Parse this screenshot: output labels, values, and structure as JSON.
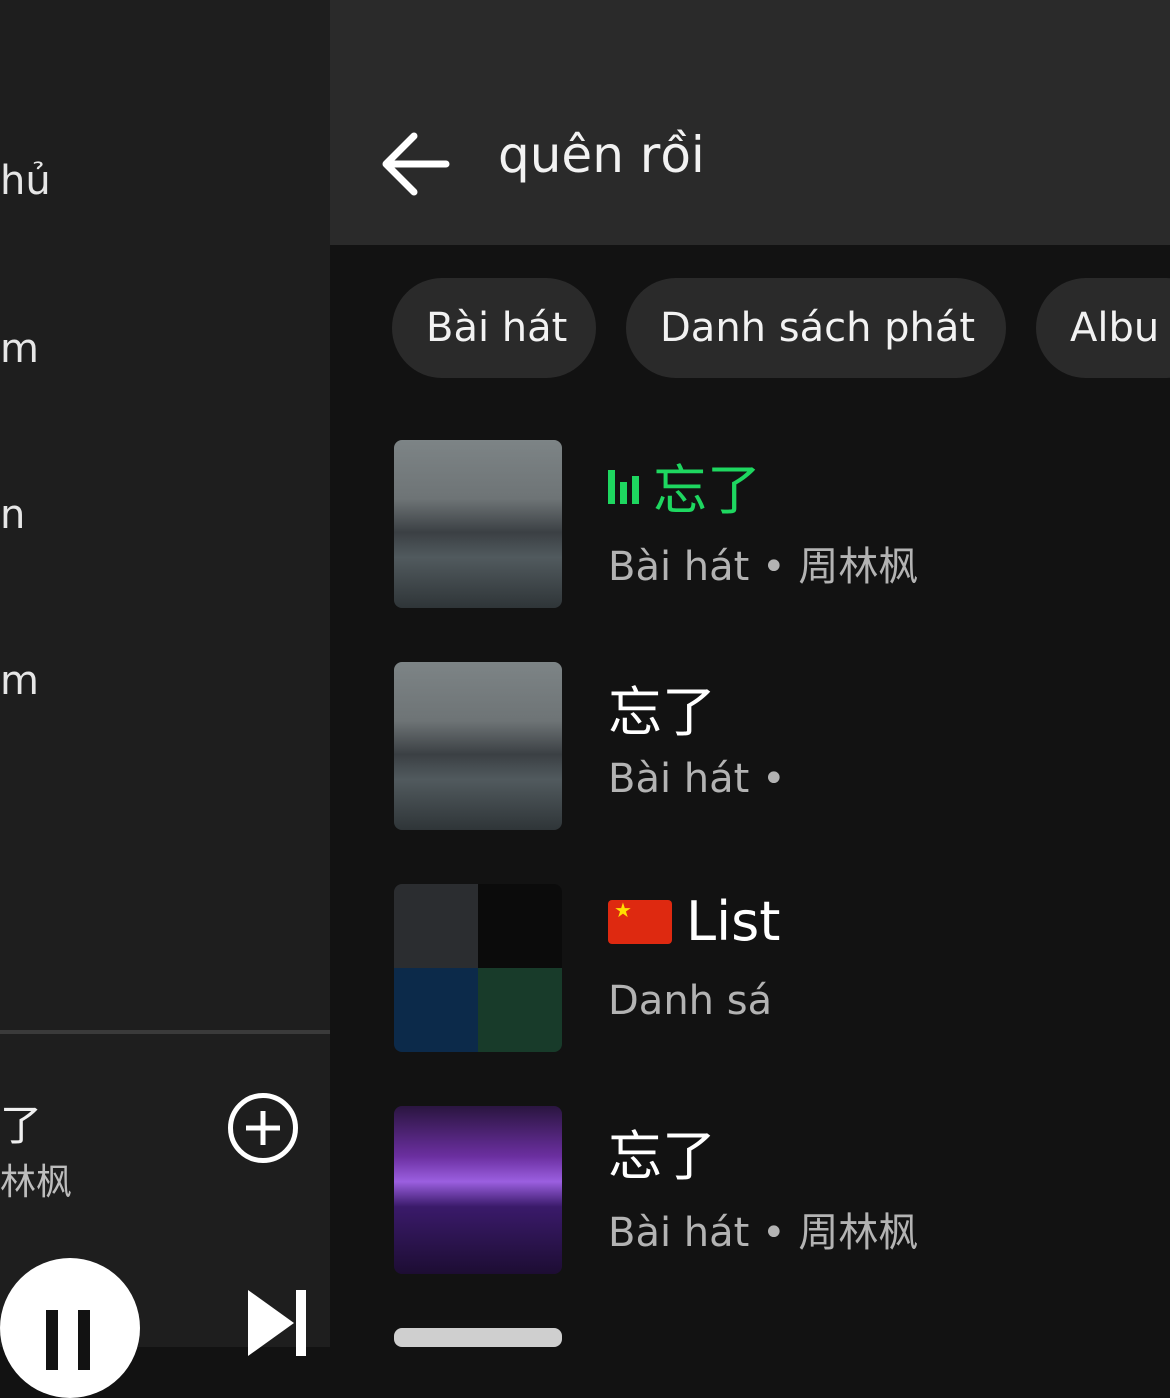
{
  "left_panel": {
    "items": [
      "hủ",
      "m",
      "n",
      "m"
    ],
    "mini_player": {
      "title": "了",
      "artist": "林枫"
    }
  },
  "search": {
    "query": "quên rồi"
  },
  "chips": [
    "Bài hát",
    "Danh sách phát",
    "Albu"
  ],
  "results": [
    {
      "title": "忘了",
      "subtitle": "Bài hát • 周林枫",
      "playing": true
    },
    {
      "title": "忘了",
      "subtitle": "Bài hát •",
      "playing": false
    },
    {
      "title": "List",
      "subtitle": "Danh sá",
      "playing": false,
      "flag": "china-flag"
    },
    {
      "title": "忘了",
      "subtitle": "Bài hát • 周林枫",
      "playing": false
    }
  ],
  "colors": {
    "accent": "#1ed760",
    "background": "#121212",
    "header": "#2a2a2a"
  }
}
